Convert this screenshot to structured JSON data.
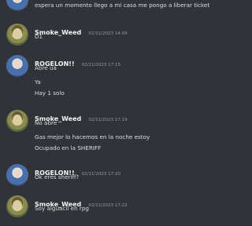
{
  "messages": [
    {
      "author": "",
      "time": "",
      "lines": [
        "espera un momento llego a mi casa me pongo a liberar ticket"
      ]
    },
    {
      "author": "Smoke_Weed",
      "time": "02/11/2023 14:09",
      "lines": [
        "D1"
      ]
    },
    {
      "author": "ROGELON!!",
      "time": "02/11/2023 17:15",
      "lines": [
        "Abre ua",
        "Ya",
        "Hay 1 solo"
      ]
    },
    {
      "author": "Smoke_Weed",
      "time": "02/11/2023 17:19",
      "lines": [
        "No abre",
        "Gas mejor lo hacemos en la noche estoy",
        "Ocupado en la SHERIFF"
      ]
    },
    {
      "author": "ROGELON!!",
      "time": "02/11/2023 17:20",
      "lines": [
        "Ok eres sheriff?"
      ]
    },
    {
      "author": "Smoke_Weed",
      "time": "02/11/2023 17:22",
      "lines": [
        "Soy alguacil  en rpg"
      ]
    }
  ]
}
